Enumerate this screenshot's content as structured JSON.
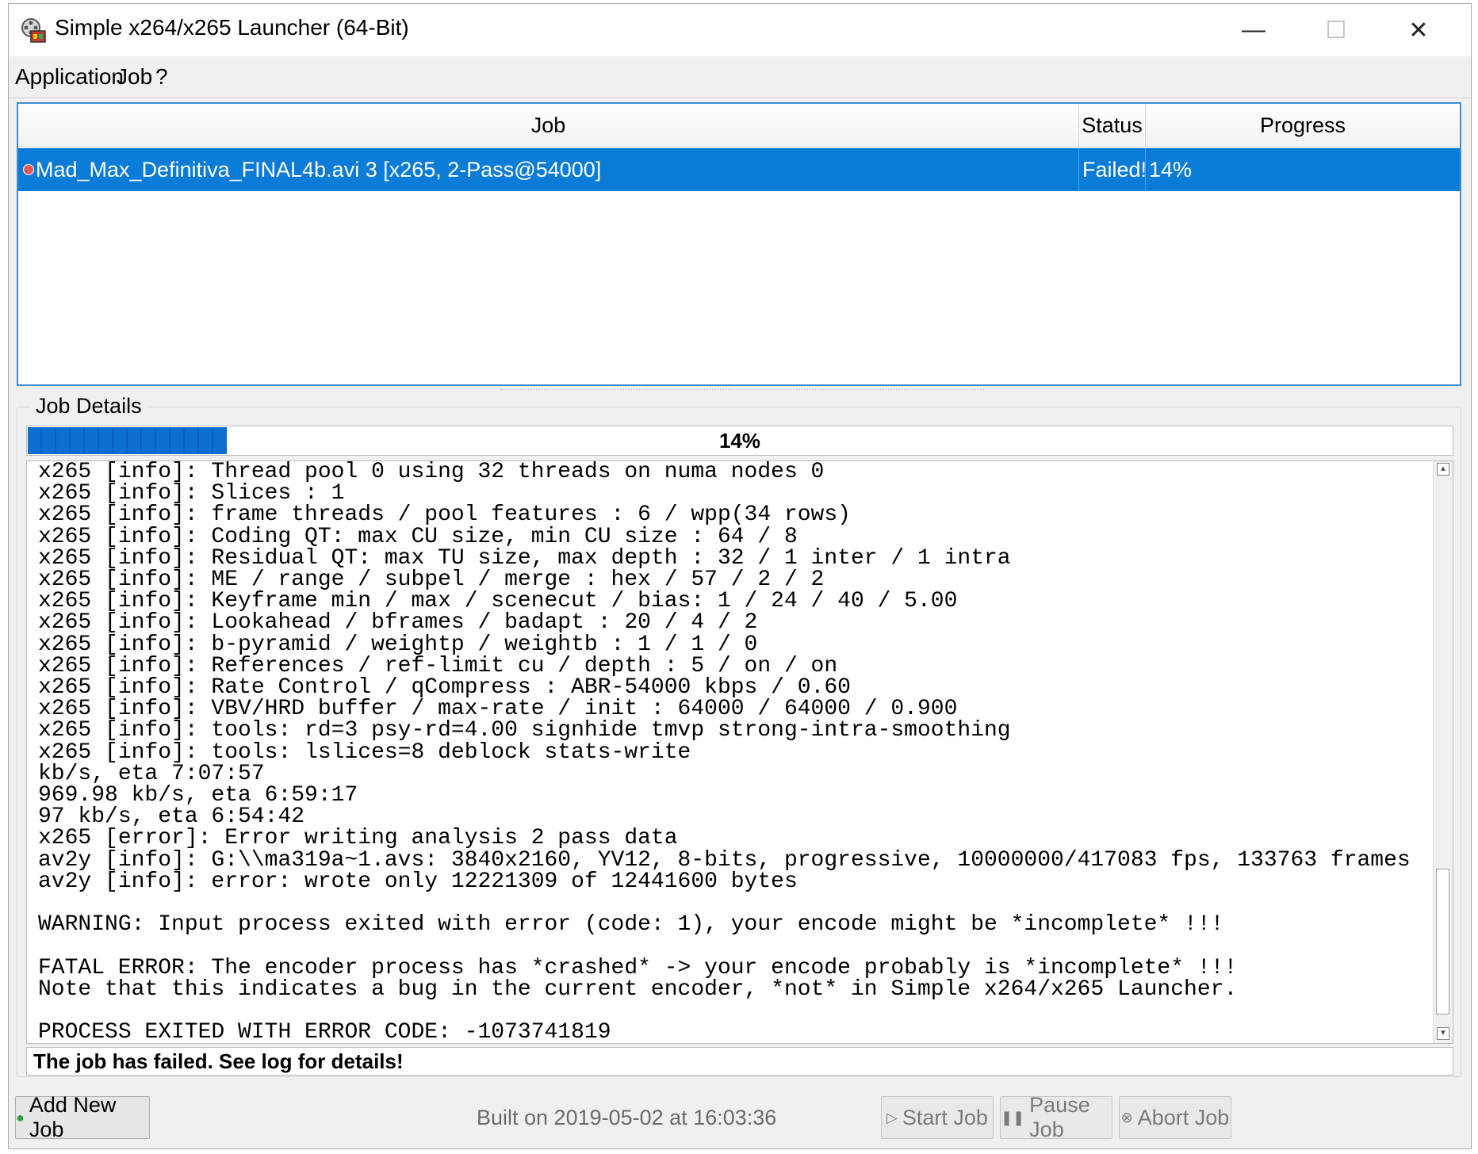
{
  "window": {
    "title": "Simple x264/x265 Launcher (64-Bit)",
    "controls": {
      "minimize": "—",
      "maximize": "☐",
      "close": "✕"
    }
  },
  "menu": [
    "Application",
    "Job",
    "?"
  ],
  "jobs_table": {
    "columns": [
      "Job",
      "Status",
      "Progress"
    ],
    "rows": [
      {
        "job": "Mad_Max_Definitiva_FINAL4b.avi 3 [x265, 2-Pass@54000]",
        "status": "Failed!",
        "progress": "14%"
      }
    ]
  },
  "job_details": {
    "label": "Job Details",
    "progress_text": "14%",
    "progress_fraction": 0.14,
    "log_lines": [
      "x265 [info]: Thread pool 0 using 32 threads on numa nodes 0",
      "x265 [info]: Slices : 1",
      "x265 [info]: frame threads / pool features : 6 / wpp(34 rows)",
      "x265 [info]: Coding QT: max CU size, min CU size : 64 / 8",
      "x265 [info]: Residual QT: max TU size, max depth : 32 / 1 inter / 1 intra",
      "x265 [info]: ME / range / subpel / merge : hex / 57 / 2 / 2",
      "x265 [info]: Keyframe min / max / scenecut / bias: 1 / 24 / 40 / 5.00",
      "x265 [info]: Lookahead / bframes / badapt : 20 / 4 / 2",
      "x265 [info]: b-pyramid / weightp / weightb : 1 / 1 / 0",
      "x265 [info]: References / ref-limit cu / depth : 5 / on / on",
      "x265 [info]: Rate Control / qCompress : ABR-54000 kbps / 0.60",
      "x265 [info]: VBV/HRD buffer / max-rate / init : 64000 / 64000 / 0.900",
      "x265 [info]: tools: rd=3 psy-rd=4.00 signhide tmvp strong-intra-smoothing",
      "x265 [info]: tools: lslices=8 deblock stats-write",
      "kb/s, eta 7:07:57",
      "969.98 kb/s, eta 6:59:17",
      "97 kb/s, eta 6:54:42",
      "x265 [error]: Error writing analysis 2 pass data",
      "av2y [info]: G:\\\\ma319a~1.avs: 3840x2160, YV12, 8-bits, progressive, 10000000/417083 fps, 133763 frames",
      "av2y [info]: error: wrote only 12221309 of 12441600 bytes",
      "",
      "WARNING: Input process exited with error (code: 1), your encode might be *incomplete* !!!",
      "",
      "FATAL ERROR: The encoder process has *crashed* -> your encode probably is *incomplete* !!!",
      "Note that this indicates a bug in the current encoder, *not* in Simple x264/x265 Launcher.",
      "",
      "PROCESS EXITED WITH ERROR CODE: -1073741819"
    ],
    "status_message": "The job has failed. See log for details!"
  },
  "bottom_bar": {
    "add_job": "Add New Job",
    "built": "Built on 2019-05-02 at 16:03:36",
    "start_job": "Start Job",
    "pause_job": "Pause Job",
    "abort_job": "Abort Job"
  },
  "colors": {
    "selection": "#0a7bd6",
    "progress": "#0a6fd0",
    "window_bg": "#f0f0f0"
  },
  "icons": [
    "app-film-icon",
    "error-dot-icon",
    "add-plus-icon",
    "play-icon",
    "pause-icon",
    "abort-x-icon"
  ]
}
